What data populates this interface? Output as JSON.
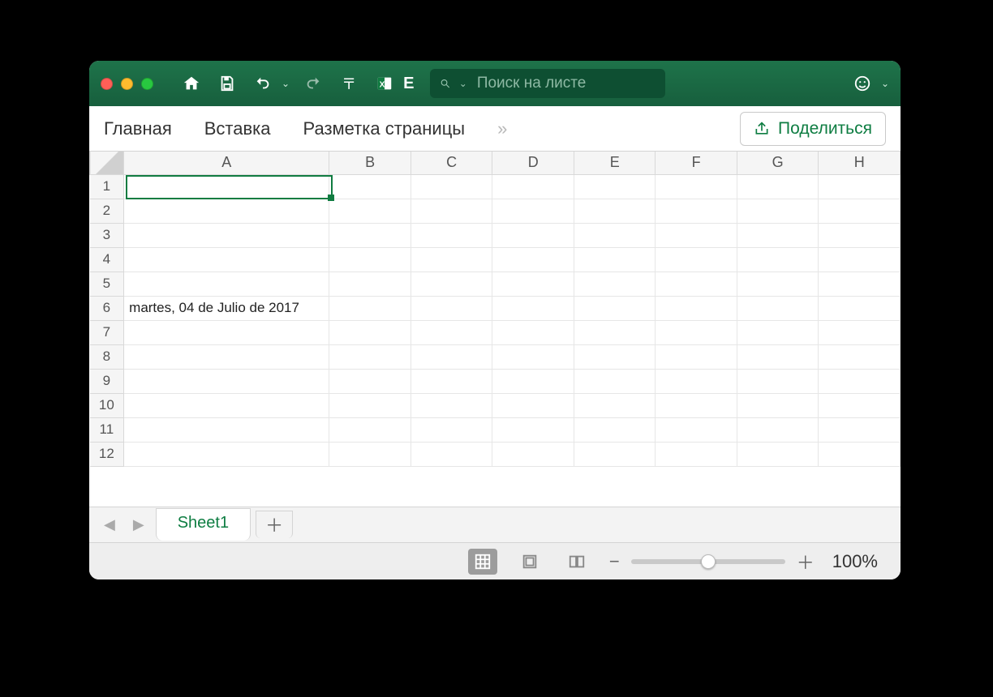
{
  "titlebar": {
    "search_placeholder": "Поиск на листе",
    "doc_indicator": "E"
  },
  "ribbon": {
    "tabs": [
      "Главная",
      "Вставка",
      "Разметка страницы"
    ],
    "more": "»",
    "share_label": "Поделиться"
  },
  "grid": {
    "columns": [
      "A",
      "B",
      "C",
      "D",
      "E",
      "F",
      "G",
      "H"
    ],
    "row_count": 12,
    "active_cell": "A1",
    "cells": {
      "A6": "martes, 04 de Julio de 2017"
    }
  },
  "sheets": {
    "active": "Sheet1"
  },
  "status": {
    "zoom": "100%"
  }
}
